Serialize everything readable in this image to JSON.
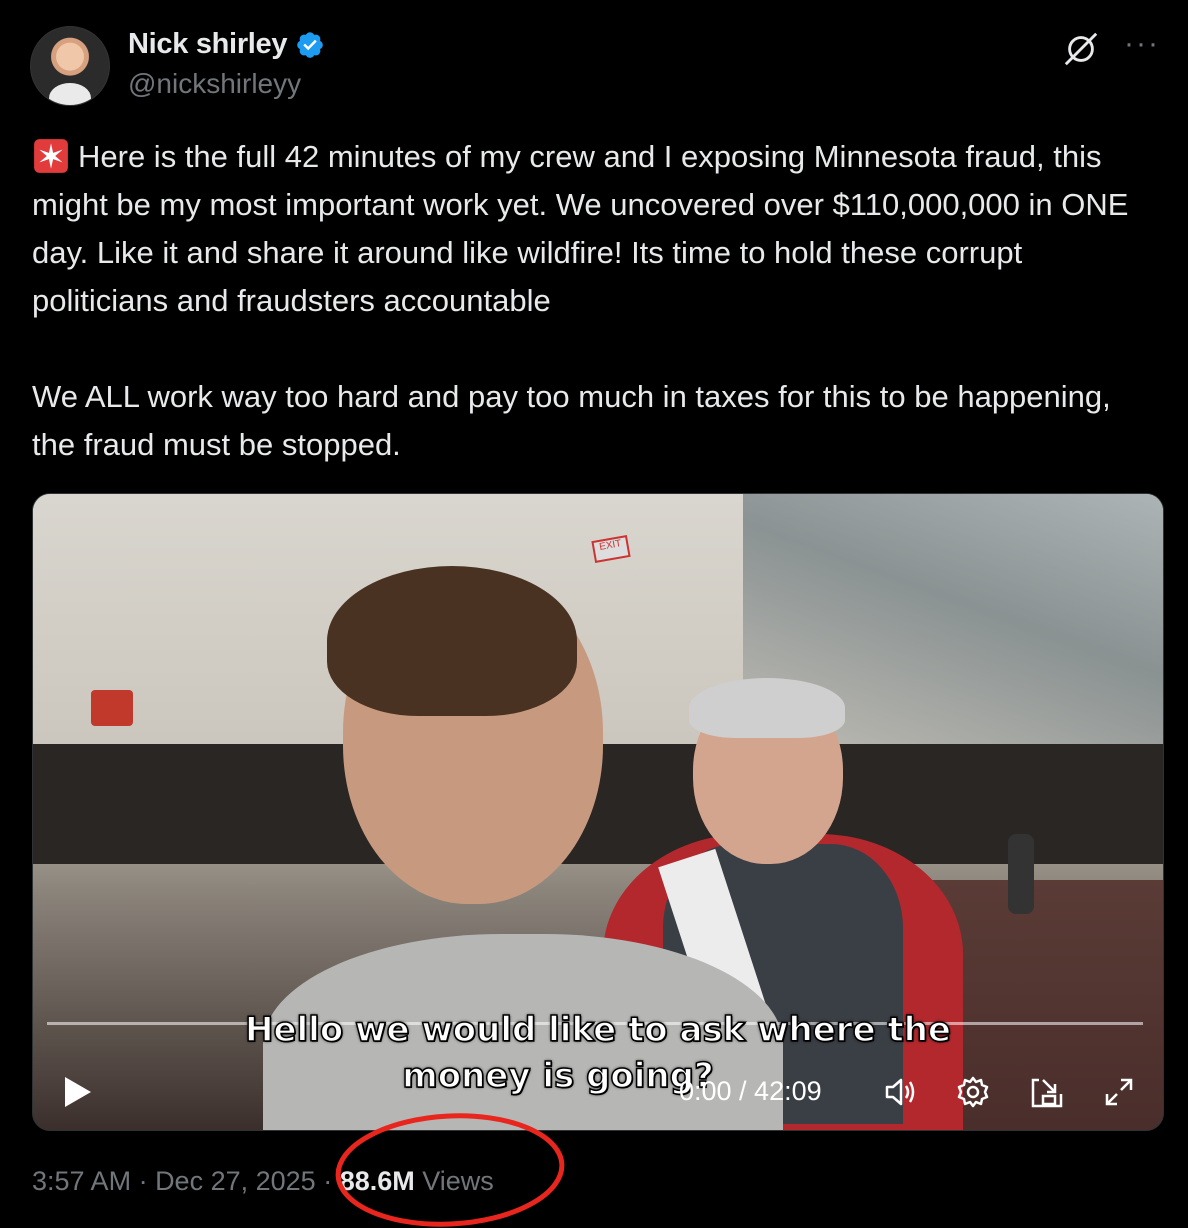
{
  "author": {
    "display_name": "Nick shirley",
    "handle": "@nickshirleyy",
    "verified_color": "#1d9bf0",
    "avatar_icon": "profile-photo"
  },
  "icons": {
    "grok": "grok-icon",
    "more": "···",
    "siren": "rotating-light-emoji"
  },
  "tweet": {
    "paragraph1": "Here is the full 42 minutes of my crew and I exposing Minnesota fraud, this might be my most important work yet. We uncovered over $110,000,000 in ONE day. Like it and share it around like wildfire! Its time to hold these corrupt politicians and fraudsters accountable",
    "paragraph2": "We ALL work way too hard and pay too much in taxes for this to be happening, the fraud must be stopped."
  },
  "video": {
    "subtitle_line1": "Hello we would like to ask where the",
    "subtitle_line2": "money is going?",
    "time_display": "0:00 / 42:09",
    "exit_sign": "EXIT"
  },
  "footer": {
    "time": "3:57 AM",
    "separator": " · ",
    "date": "Dec 27, 2025",
    "views_count": "88.6M",
    "views_label": " Views"
  },
  "annotation_color": "#e8261d"
}
